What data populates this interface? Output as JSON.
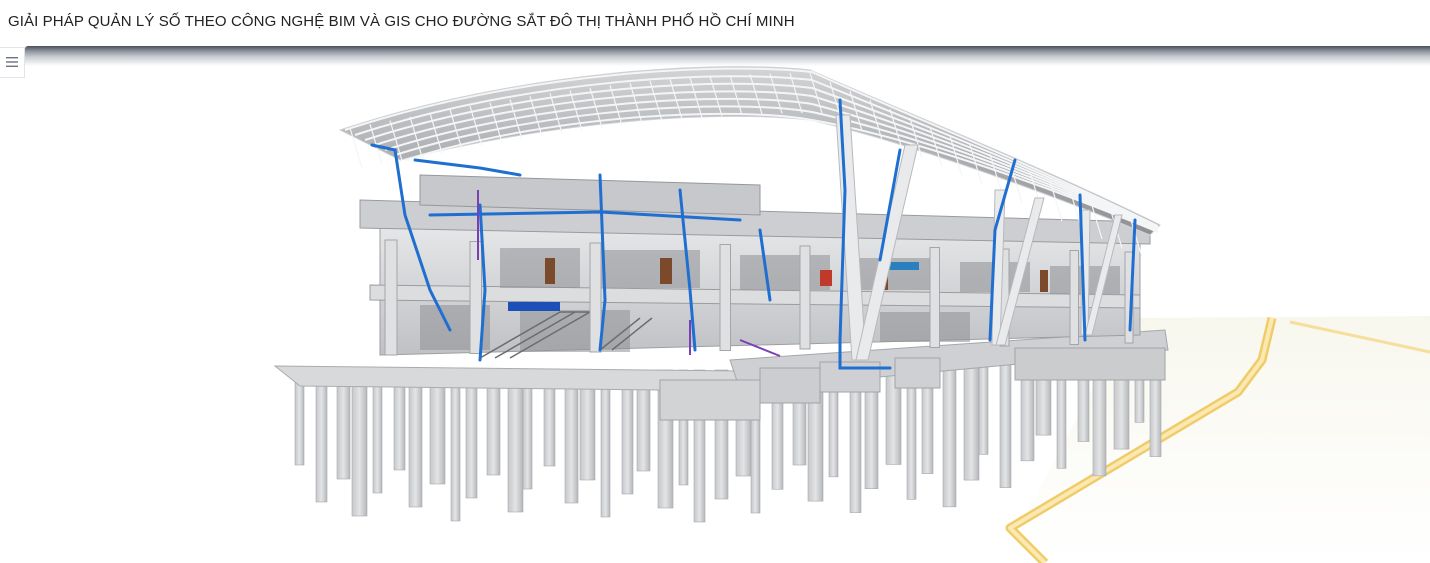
{
  "header": {
    "title": "GIẢI PHÁP QUẢN LÝ SỐ THEO CÔNG NGHỆ BIM VÀ GIS CHO ĐƯỜNG SẮT ĐÔ THỊ THÀNH PHỐ HỒ CHÍ MINH"
  },
  "sidebar_toggle": {
    "icon": "hamburger-menu-icon"
  },
  "viewer": {
    "content": "bim-3d-station-model",
    "colors": {
      "structure": "#d9dadc",
      "roof_truss": "#f2f3f5",
      "pipes": "#1f6fd1",
      "road": "#f2d37a",
      "sky": "#ffffff"
    },
    "signs": [
      "",
      ""
    ]
  }
}
